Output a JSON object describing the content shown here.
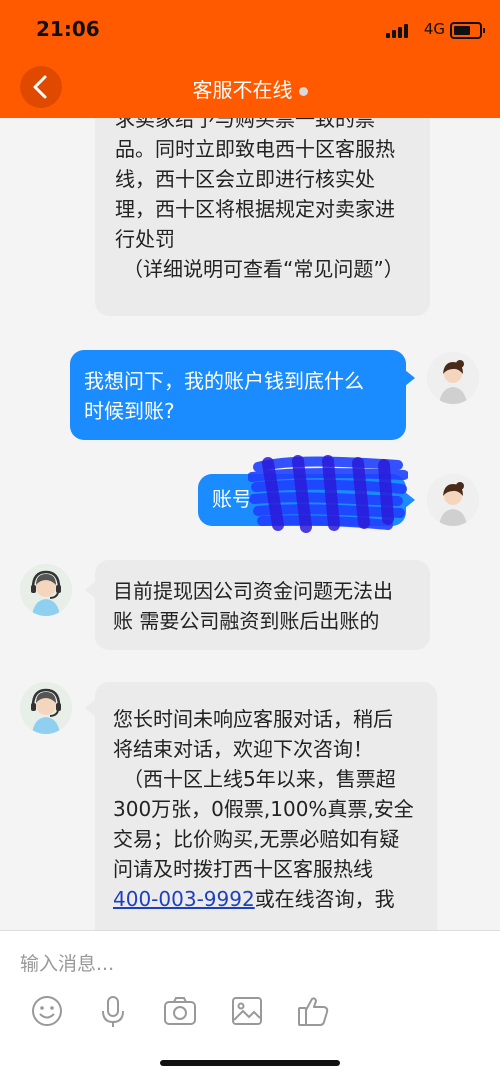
{
  "status_bar": {
    "time": "21:06",
    "network": "4G"
  },
  "nav": {
    "title": "客服不在线"
  },
  "messages": [
    {
      "side": "left",
      "lines": [
        "求卖家给予与购买票一致的票",
        "品。同时立即致电西十区客服热",
        "线，西十区会立即进行核实处",
        "理，西十区将根据规定对卖家进",
        "行处罚",
        "（详细说明可查看“常见问题”）"
      ]
    },
    {
      "side": "right",
      "lines": [
        "我想问下，我的账户钱到底什么",
        "时候到账?"
      ]
    },
    {
      "side": "right",
      "lines": [
        "账号"
      ]
    },
    {
      "side": "left",
      "lines": [
        "目前提现因公司资金问题无法出",
        "账 需要公司融资到账后出账的"
      ]
    },
    {
      "side": "left",
      "lines": [
        "您长时间未响应客服对话，稍后",
        "将结束对话，欢迎下次咨询！",
        "（西十区上线5年以来，售票超",
        "300万张，0假票,100%真票,安全",
        "交易；比价购买,无票必赔如有疑",
        "问请及时拨打西十区客服热线"
      ],
      "phone": "400-003-9992",
      "after_phone": "或在线咨询，我"
    }
  ],
  "input": {
    "placeholder": "输入消息..."
  },
  "toolbar": {
    "icons": [
      "emoji-icon",
      "microphone-icon",
      "camera-icon",
      "image-icon",
      "thumbs-up-icon"
    ]
  },
  "colors": {
    "header": "#ff5a00",
    "sent_bubble": "#1a8cff",
    "received_bubble": "#ebebeb",
    "link": "#1e3fbf"
  }
}
